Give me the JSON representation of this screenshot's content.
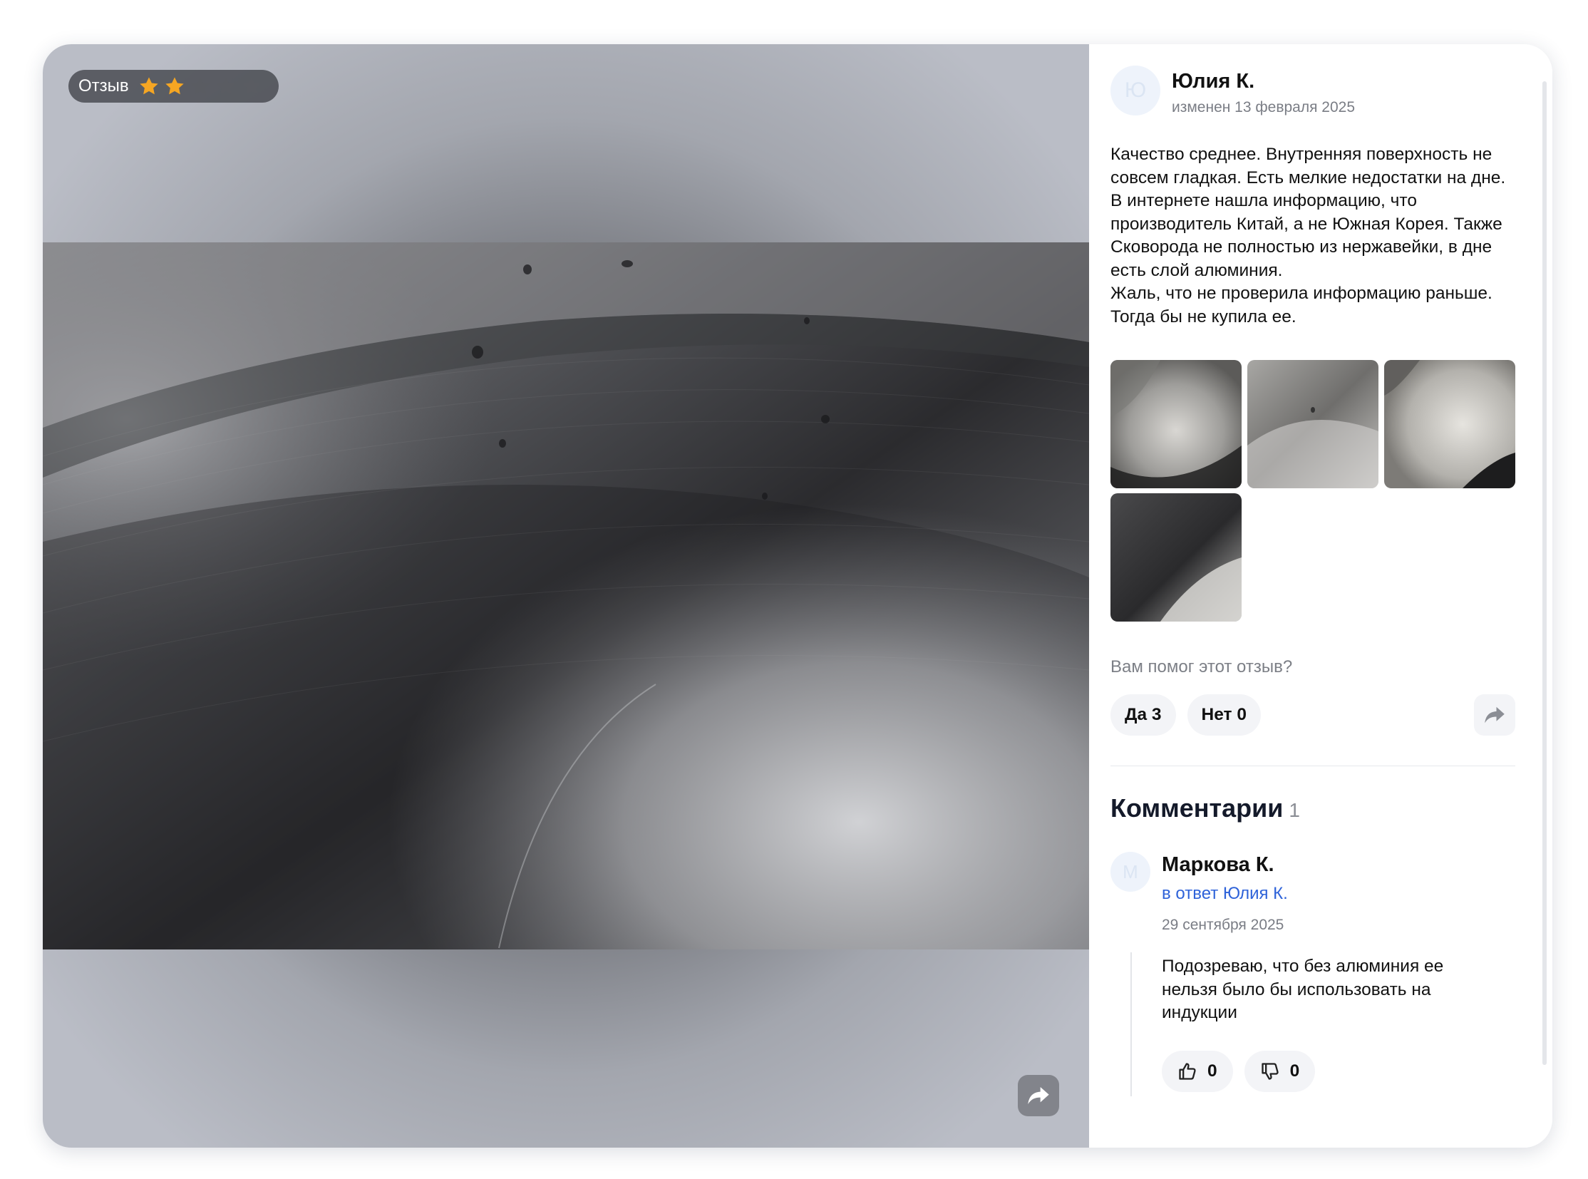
{
  "review_badge": {
    "label": "Отзыв",
    "rating": 2,
    "max_rating": 5,
    "filled_color": "#f5a623",
    "empty_color": "#5a5c62"
  },
  "author": {
    "initial": "Ю",
    "name": "Юлия К.",
    "date": "изменен 13 февраля 2025"
  },
  "review_text": "Качество среднее. Внутренняя поверхность не совсем гладкая. Есть мелкие недостатки на дне.\nВ интернете нашла информацию, что производитель Китай, а не Южная Корея. Также Сковорода не полностью из нержавейки, в дне есть слой алюминия.\nЖаль, что не проверила информацию раньше. Тогда бы не купила ее.",
  "helpful": {
    "question": "Вам помог этот отзыв?",
    "yes_label": "Да 3",
    "no_label": "Нет 0"
  },
  "comments": {
    "title": "Комментарии",
    "count": "1",
    "items": [
      {
        "initial": "М",
        "name": "Маркова К.",
        "reply_to": "в ответ Юлия К.",
        "date": "29 сентября 2025",
        "text": "Подозреваю, что без алюминия ее нельзя было бы использовать на индукции",
        "likes": "0",
        "dislikes": "0"
      }
    ]
  },
  "icons": {
    "share": "share-arrow-icon",
    "like": "thumbs-up-icon",
    "dislike": "thumbs-down-icon",
    "star": "star-icon"
  },
  "colors": {
    "link": "#2f63d9",
    "accent_star": "#f5a623"
  }
}
